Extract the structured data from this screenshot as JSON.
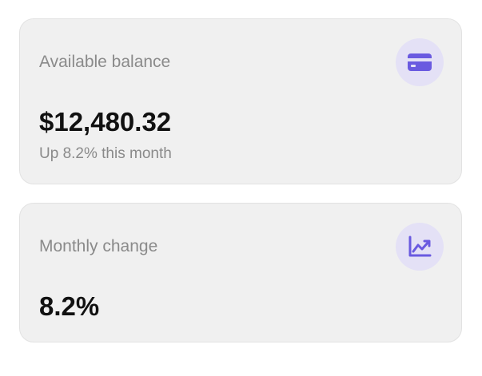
{
  "cards": [
    {
      "label": "Available balance",
      "value": "$12,480.32",
      "subtext": "Up 8.2% this month",
      "icon": "credit-card-icon"
    },
    {
      "label": "Monthly change",
      "value": "8.2%",
      "icon": "line-chart-icon"
    }
  ],
  "colors": {
    "card_background": "#f0f0f0",
    "icon_background": "#e4e1f6",
    "accent": "#6a5ae0",
    "muted_text": "#8a8a8a",
    "value_text": "#111111"
  }
}
